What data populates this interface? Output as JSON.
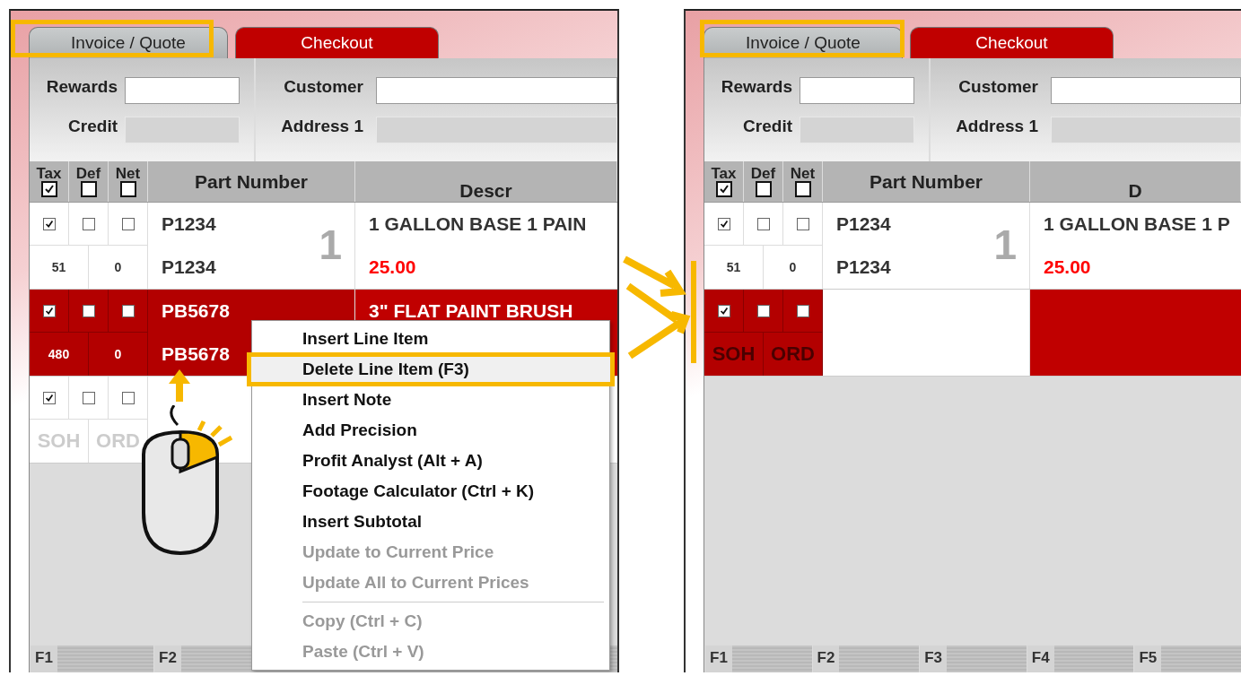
{
  "panels": [
    {
      "tabs": [
        {
          "label": "Invoice / Quote",
          "selected": true
        },
        {
          "label": "Checkout",
          "selected": false
        }
      ],
      "form": {
        "rewards_label": "Rewards",
        "credit_label": "Credit",
        "customer_label": "Customer",
        "address_label": "Address 1"
      },
      "flags": [
        {
          "label": "Tax",
          "checked": true
        },
        {
          "label": "Def",
          "checked": false
        },
        {
          "label": "Net",
          "checked": false
        }
      ],
      "columns": {
        "part": "Part Number",
        "description": "Descr"
      },
      "rows": [
        {
          "kind": "item",
          "selected": false,
          "tax": true,
          "def": false,
          "net": false,
          "soh": "51",
          "ord": "0",
          "part": "P1234",
          "part_2": "P1234",
          "line": "1",
          "description": "1 GALLON BASE 1 PAIN",
          "price": "25.00"
        },
        {
          "kind": "item",
          "selected": true,
          "tax": true,
          "def": false,
          "net": false,
          "soh": "480",
          "ord": "0",
          "part": "PB5678",
          "part_2": "PB5678",
          "description": "3\" FLAT PAINT BRUSH"
        },
        {
          "kind": "new",
          "selected": false,
          "tax": true,
          "def": false,
          "net": false,
          "soh": "SOH",
          "ord": "ORD"
        }
      ],
      "context_menu": [
        {
          "label": "Insert Line Item",
          "disabled": false,
          "selected": false,
          "separator_before": false
        },
        {
          "label": "Delete Line Item (F3)",
          "disabled": false,
          "selected": true,
          "separator_before": false
        },
        {
          "label": "Insert Note",
          "disabled": false,
          "selected": false,
          "separator_before": false
        },
        {
          "label": "Add Precision",
          "disabled": false,
          "selected": false,
          "separator_before": false
        },
        {
          "label": "Profit Analyst (Alt + A)",
          "disabled": false,
          "selected": false,
          "separator_before": false
        },
        {
          "label": "Footage Calculator (Ctrl + K)",
          "disabled": false,
          "selected": false,
          "separator_before": false
        },
        {
          "label": "Insert Subtotal",
          "disabled": false,
          "selected": false,
          "separator_before": false
        },
        {
          "label": "Update to Current Price",
          "disabled": true,
          "selected": false,
          "separator_before": false
        },
        {
          "label": "Update All to Current Prices",
          "disabled": true,
          "selected": false,
          "separator_before": false
        },
        {
          "label": "Copy (Ctrl + C)",
          "disabled": true,
          "selected": false,
          "separator_before": true
        },
        {
          "label": "Paste (Ctrl + V)",
          "disabled": true,
          "selected": false,
          "separator_before": false
        }
      ],
      "function_keys": [
        "F1",
        "F2"
      ]
    },
    {
      "tabs": [
        {
          "label": "Invoice / Quote",
          "selected": true
        },
        {
          "label": "Checkout",
          "selected": false
        }
      ],
      "form": {
        "rewards_label": "Rewards",
        "credit_label": "Credit",
        "customer_label": "Customer",
        "address_label": "Address 1"
      },
      "flags": [
        {
          "label": "Tax",
          "checked": true
        },
        {
          "label": "Def",
          "checked": false
        },
        {
          "label": "Net",
          "checked": false
        }
      ],
      "columns": {
        "part": "Part Number",
        "description": "D"
      },
      "rows": [
        {
          "kind": "item",
          "selected": false,
          "tax": true,
          "def": false,
          "net": false,
          "soh": "51",
          "ord": "0",
          "part": "P1234",
          "part_2": "P1234",
          "line": "1",
          "description": "1 GALLON BASE 1 P",
          "price": "25.00"
        },
        {
          "kind": "new",
          "selected": true,
          "tax": true,
          "def": false,
          "net": false,
          "soh": "SOH",
          "ord": "ORD"
        }
      ],
      "function_keys": [
        "F1",
        "F2",
        "F3",
        "F4",
        "F5"
      ]
    }
  ]
}
